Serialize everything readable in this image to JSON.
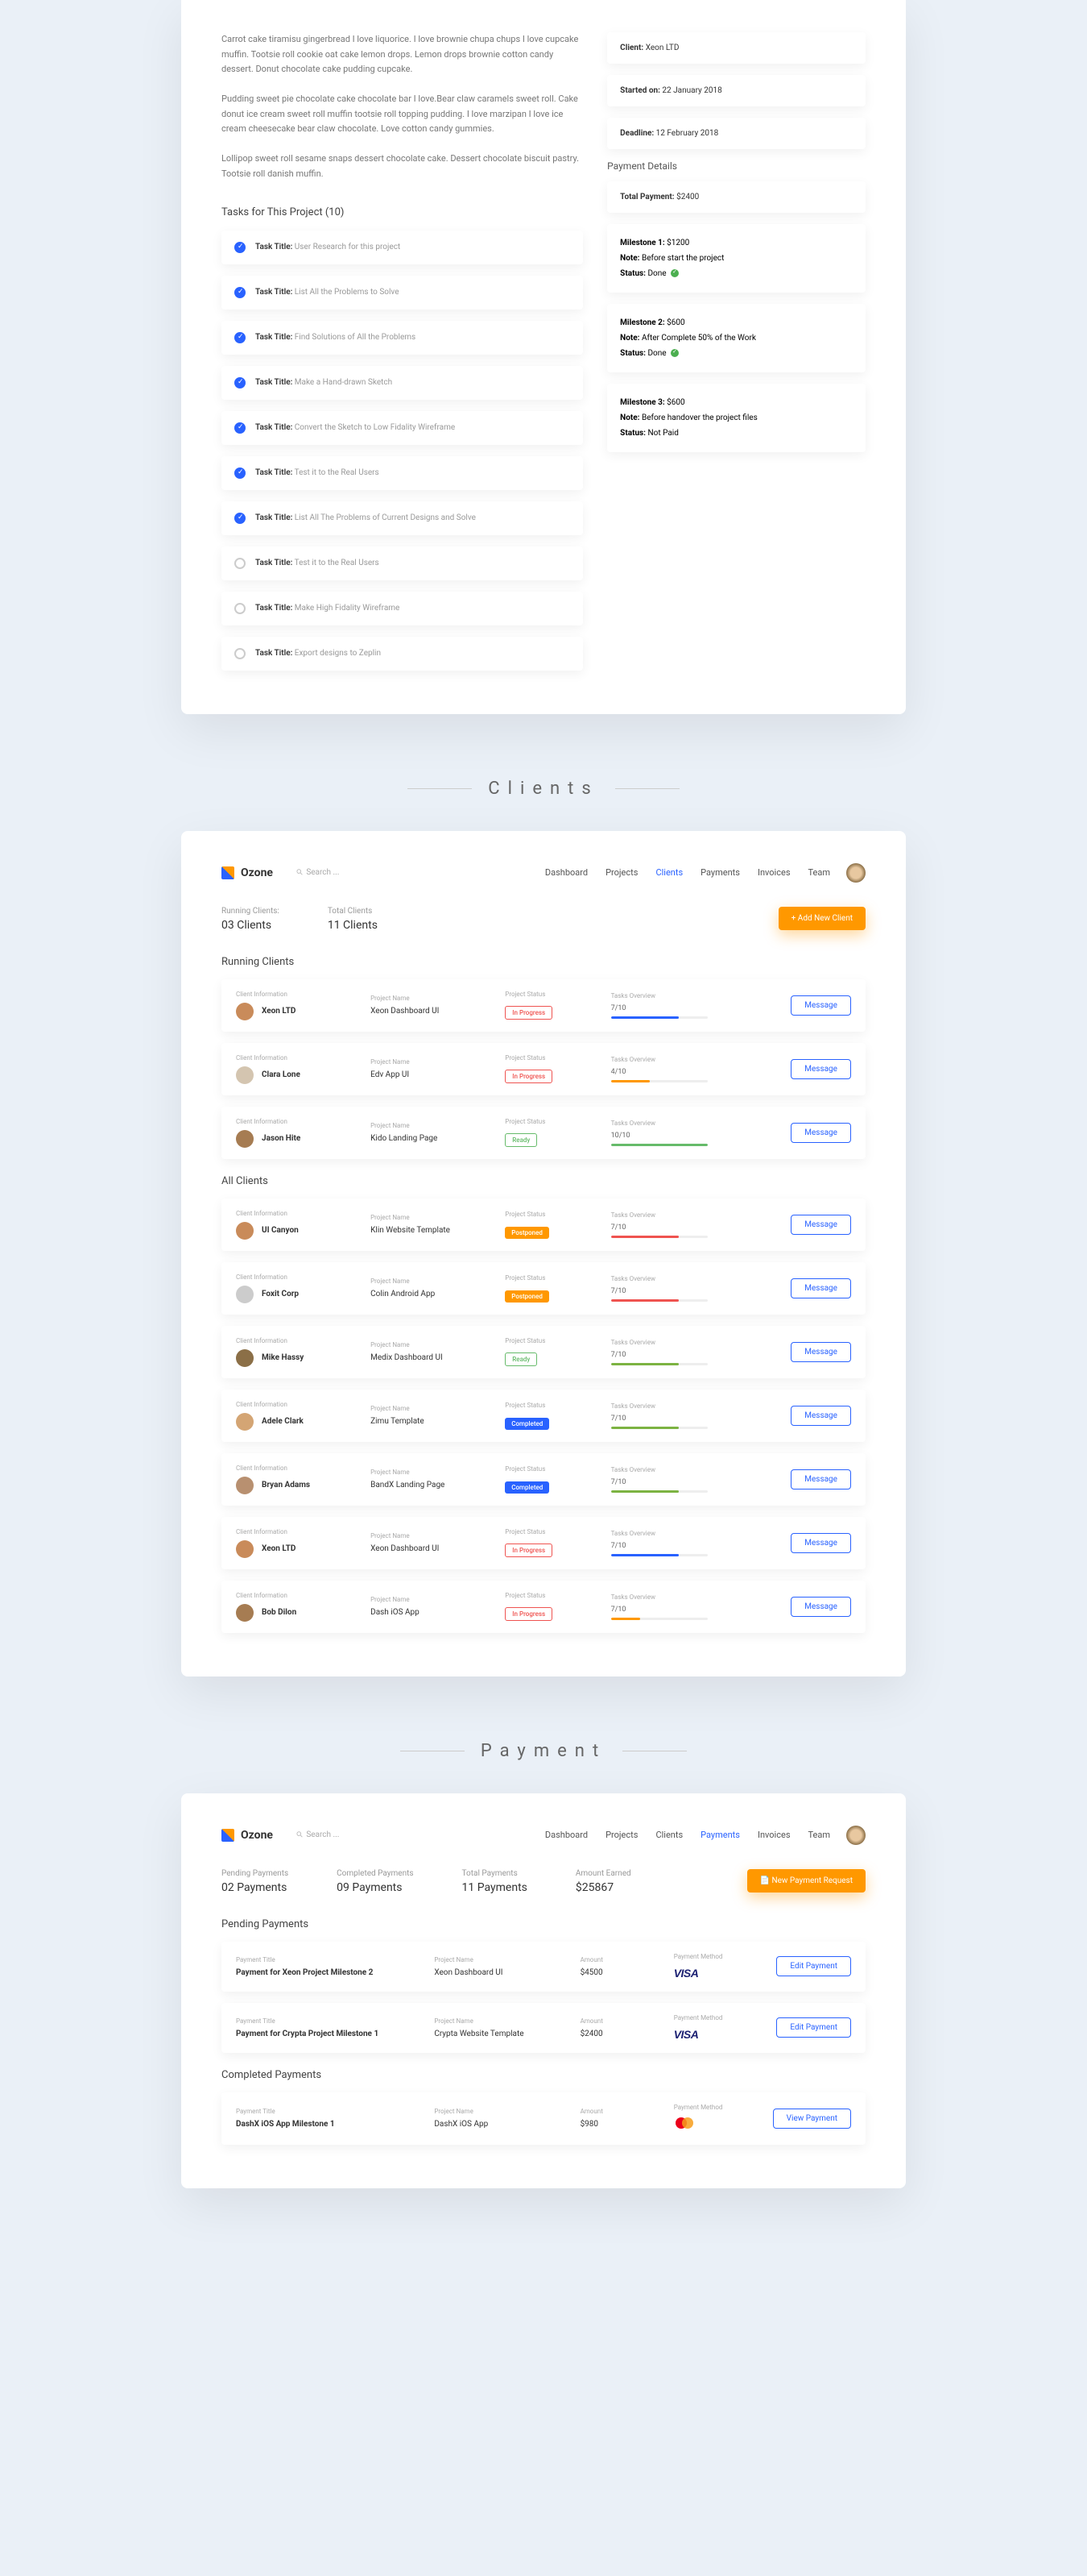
{
  "project_top": {
    "desc1": "Carrot cake tiramisu gingerbread I love liquorice. I love brownie chupa chups I love cupcake muffin. Tootsie roll cookie oat cake lemon drops. Lemon drops brownie cotton candy dessert. Donut chocolate cake pudding cupcake.",
    "desc2": "Pudding sweet pie chocolate cake chocolate bar I love.Bear claw caramels sweet roll. Cake donut ice cream sweet roll muffin tootsie roll topping pudding. I love marzipan I love ice cream cheesecake bear claw chocolate. Love cotton candy gummies.",
    "desc3": "Lollipop sweet roll sesame snaps dessert chocolate cake. Dessert chocolate biscuit pastry. Tootsie roll danish muffin.",
    "tasks_heading": "Tasks for This Project (10)",
    "task_label": "Task Title:",
    "tasks": [
      {
        "done": true,
        "title": "User Research for this project"
      },
      {
        "done": true,
        "title": "List All the Problems to Solve"
      },
      {
        "done": true,
        "title": "Find Solutions of All the Problems"
      },
      {
        "done": true,
        "title": "Make a Hand-drawn Sketch"
      },
      {
        "done": true,
        "title": "Convert the Sketch to Low Fidality Wireframe"
      },
      {
        "done": true,
        "title": "Test it to the Real Users"
      },
      {
        "done": true,
        "title": "List All The Problems of Current Designs and Solve"
      },
      {
        "done": false,
        "title": "Test it to the Real Users"
      },
      {
        "done": false,
        "title": "Make High Fidality Wireframe"
      },
      {
        "done": false,
        "title": "Export designs to Zeplin"
      }
    ],
    "meta": [
      {
        "k": "Client:",
        "v": "Xeon LTD"
      },
      {
        "k": "Started on:",
        "v": "22 January 2018"
      },
      {
        "k": "Deadline:",
        "v": "12 February 2018"
      }
    ],
    "payment_heading": "Payment Details",
    "total_payment_k": "Total Payment:",
    "total_payment_v": "$2400",
    "milestones": [
      {
        "m": "Milestone 1:",
        "amt": "$1200",
        "note": "Before start the project",
        "status": "Done",
        "paid": true
      },
      {
        "m": "Milestone 2:",
        "amt": "$600",
        "note": "After Complete 50% of the Work",
        "status": "Done",
        "paid": true
      },
      {
        "m": "Milestone 3:",
        "amt": "$600",
        "note": "Before handover the project files",
        "status": "Not Paid",
        "paid": false
      }
    ],
    "note_label": "Note:",
    "status_label": "Status:"
  },
  "section_clients": "Clients",
  "section_payment": "Payment",
  "brand": "Ozone",
  "search_ph": "Search ...",
  "nav": [
    "Dashboard",
    "Projects",
    "Clients",
    "Payments",
    "Invoices",
    "Team"
  ],
  "clients_page": {
    "stats": [
      {
        "l": "Running Clients:",
        "v": "03 Clients"
      },
      {
        "l": "Total Clients",
        "v": "11 Clients"
      }
    ],
    "add_btn": "+ Add New Client",
    "running_heading": "Running Clients",
    "all_heading": "All Clients",
    "col": {
      "ci": "Client Information",
      "pn": "Project Name",
      "ps": "Project Status",
      "to": "Tasks Overview"
    },
    "msg_btn": "Message",
    "running": [
      {
        "name": "Xeon LTD",
        "proj": "Xeon Dashboard UI",
        "status": "In Progress",
        "badge": "progress",
        "tasks": "7/10",
        "pct": 70,
        "color": "#2962ff",
        "av": "#c98b5a"
      },
      {
        "name": "Clara Lone",
        "proj": "Edv App UI",
        "status": "In Progress",
        "badge": "progress",
        "tasks": "4/10",
        "pct": 40,
        "color": "#ff9800",
        "av": "#d4c5b0"
      },
      {
        "name": "Jason Hite",
        "proj": "Kido Landing Page",
        "status": "Ready",
        "badge": "ready",
        "tasks": "10/10",
        "pct": 100,
        "color": "#66bb6a",
        "av": "#a67c52"
      }
    ],
    "all": [
      {
        "name": "UI Canyon",
        "proj": "Klin Website Template",
        "status": "Postponed",
        "badge": "postponed",
        "tasks": "7/10",
        "pct": 70,
        "color": "#ef5350",
        "av": "#c98b5a"
      },
      {
        "name": "Foxit Corp",
        "proj": "Colin Android App",
        "status": "Postponed",
        "badge": "postponed",
        "tasks": "7/10",
        "pct": 70,
        "color": "#ef5350",
        "av": "#ccc"
      },
      {
        "name": "Mike Hassy",
        "proj": "Medix Dashboard UI",
        "status": "Ready",
        "badge": "ready",
        "tasks": "7/10",
        "pct": 70,
        "color": "#7cb342",
        "av": "#8b6f47"
      },
      {
        "name": "Adele Clark",
        "proj": "Zimu Template",
        "status": "Completed",
        "badge": "completed",
        "tasks": "7/10",
        "pct": 70,
        "color": "#7cb342",
        "av": "#d4a574"
      },
      {
        "name": "Bryan Adams",
        "proj": "BandX Landing Page",
        "status": "Completed",
        "badge": "completed",
        "tasks": "7/10",
        "pct": 70,
        "color": "#7cb342",
        "av": "#b89070"
      },
      {
        "name": "Xeon LTD",
        "proj": "Xeon Dashboard UI",
        "status": "In Progress",
        "badge": "progress",
        "tasks": "7/10",
        "pct": 70,
        "color": "#2962ff",
        "av": "#c98b5a"
      },
      {
        "name": "Bob Dilon",
        "proj": "Dash iOS App",
        "status": "In Progress",
        "badge": "progress",
        "tasks": "7/10",
        "pct": 30,
        "color": "#ff9800",
        "av": "#a67c52"
      }
    ]
  },
  "payments_page": {
    "stats": [
      {
        "l": "Pending Payments",
        "v": "02 Payments"
      },
      {
        "l": "Completed Payments",
        "v": "09 Payments"
      },
      {
        "l": "Total Payments",
        "v": "11 Payments"
      },
      {
        "l": "Amount Earned",
        "v": "$25867"
      }
    ],
    "new_btn": "📄 New Payment Request",
    "pending_heading": "Pending Payments",
    "completed_heading": "Completed Payments",
    "col": {
      "pt": "Payment Title",
      "pn": "Project Name",
      "am": "Amount",
      "pm": "Payment Method"
    },
    "edit_btn": "Edit Payment",
    "view_btn": "View Payment",
    "pending": [
      {
        "title": "Payment for Xeon Project Milestone 2",
        "proj": "Xeon Dashboard UI",
        "amt": "$4500",
        "method": "visa"
      },
      {
        "title": "Payment for Crypta Project Milestone 1",
        "proj": "Crypta Website Template",
        "amt": "$2400",
        "method": "visa"
      }
    ],
    "completed": [
      {
        "title": "DashX iOS App Milestone 1",
        "proj": "DashX iOS App",
        "amt": "$980",
        "method": "mc"
      }
    ]
  }
}
